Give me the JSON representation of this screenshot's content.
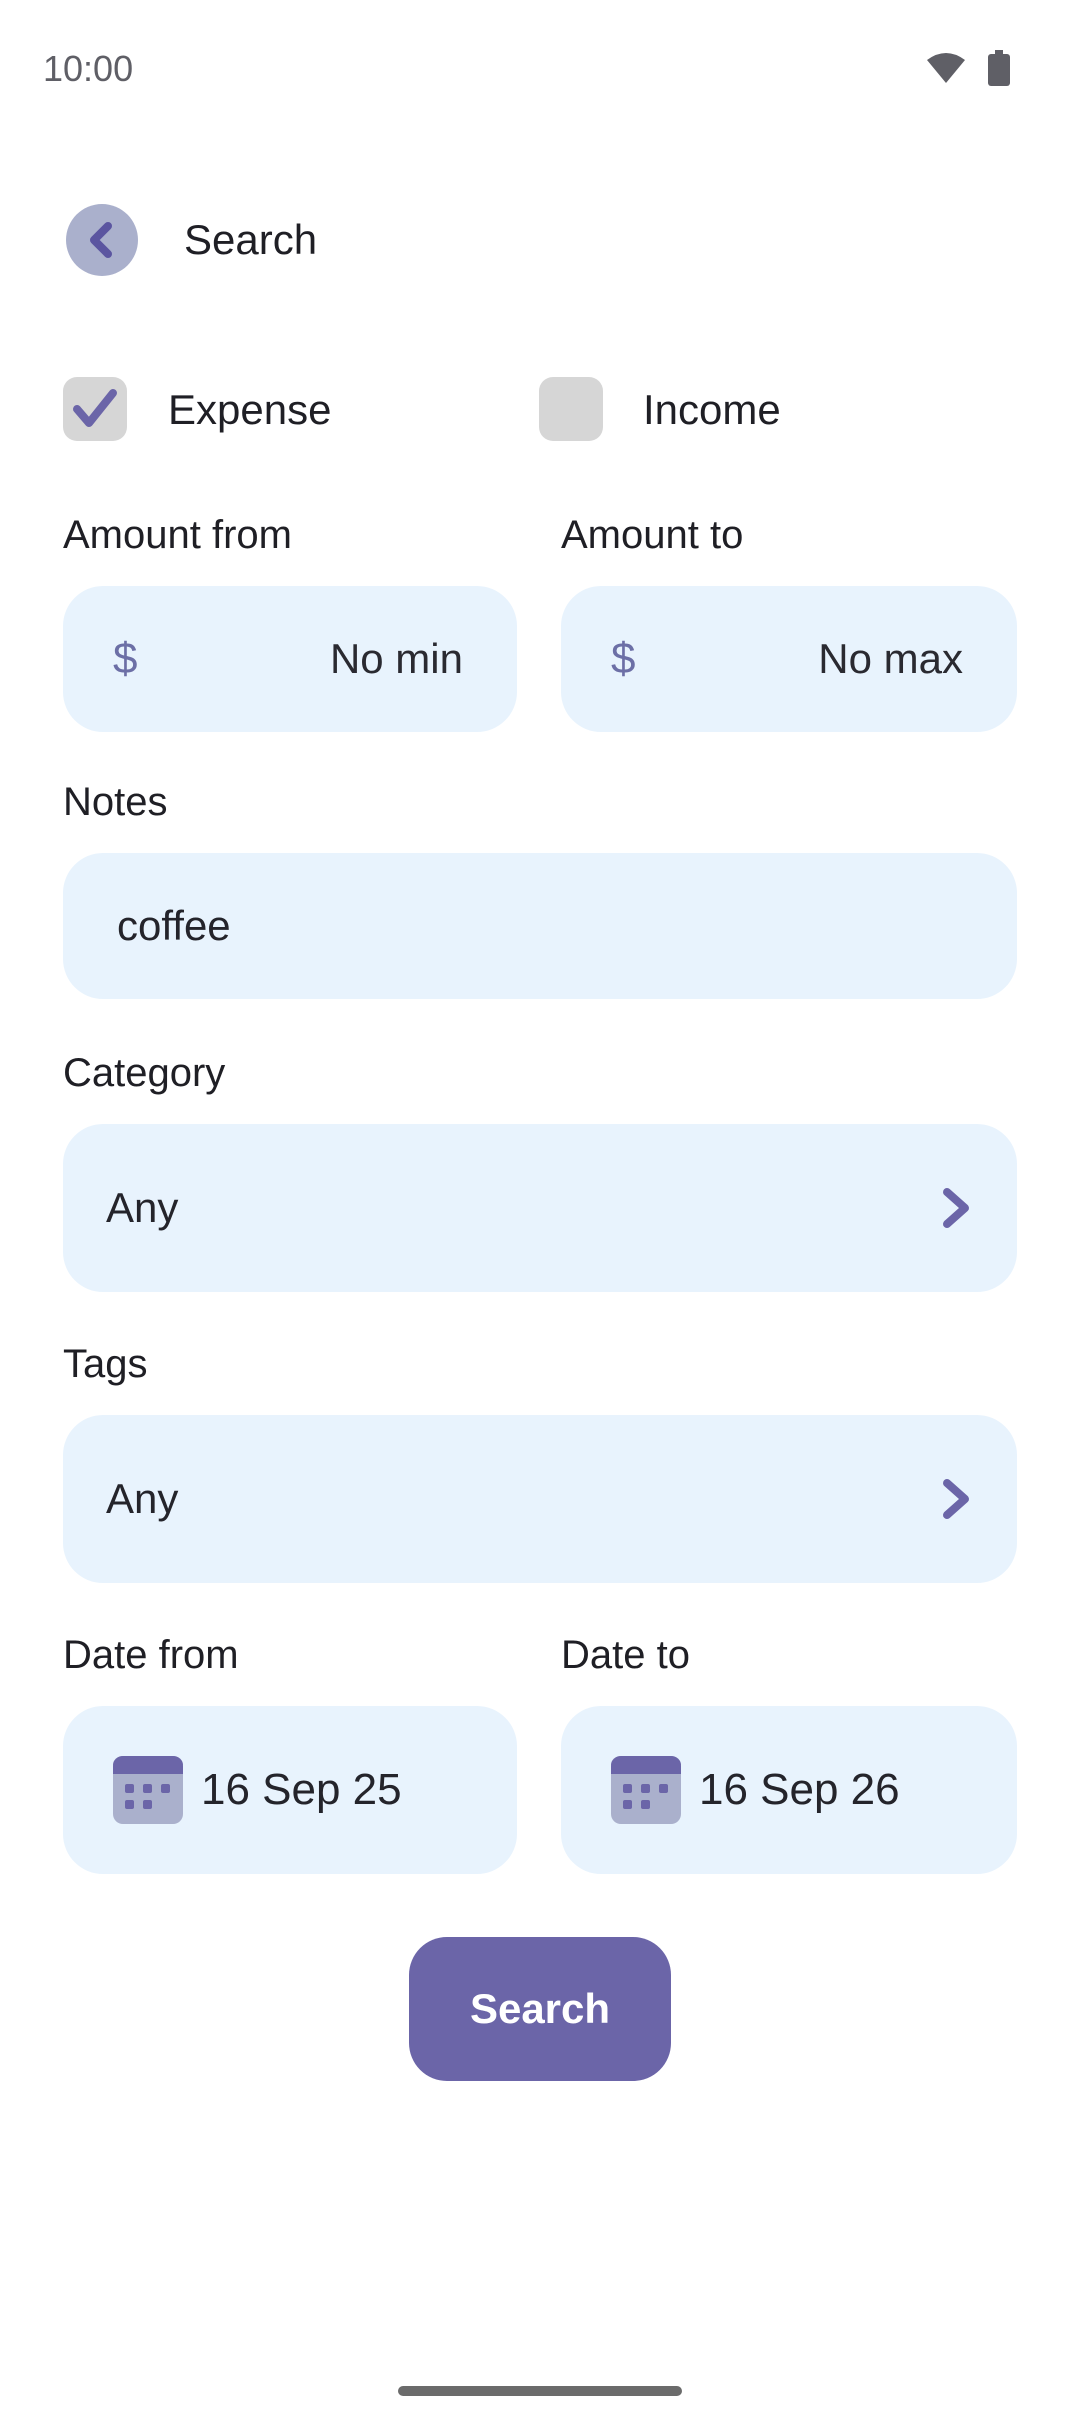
{
  "status_bar": {
    "time": "10:00",
    "icons": [
      "wifi-icon",
      "battery-icon"
    ]
  },
  "header": {
    "title": "Search",
    "back_icon": "chevron-left-icon"
  },
  "type_filters": [
    {
      "label": "Expense",
      "checked": true
    },
    {
      "label": "Income",
      "checked": false
    }
  ],
  "amount": {
    "from": {
      "label": "Amount from",
      "currency": "$",
      "placeholder": "No min"
    },
    "to": {
      "label": "Amount to",
      "currency": "$",
      "placeholder": "No max"
    }
  },
  "notes": {
    "label": "Notes",
    "value": "coffee"
  },
  "category": {
    "label": "Category",
    "value": "Any"
  },
  "tags": {
    "label": "Tags",
    "value": "Any"
  },
  "dates": {
    "from": {
      "label": "Date from",
      "value": "16 Sep 25"
    },
    "to": {
      "label": "Date to",
      "value": "16 Sep 26"
    }
  },
  "search_button": {
    "label": "Search"
  },
  "colors": {
    "accent": "#6b65a8",
    "field_bg": "#e8f3fd",
    "checkbox_bg": "#d6d6d6",
    "back_bg": "#aab0cc"
  }
}
